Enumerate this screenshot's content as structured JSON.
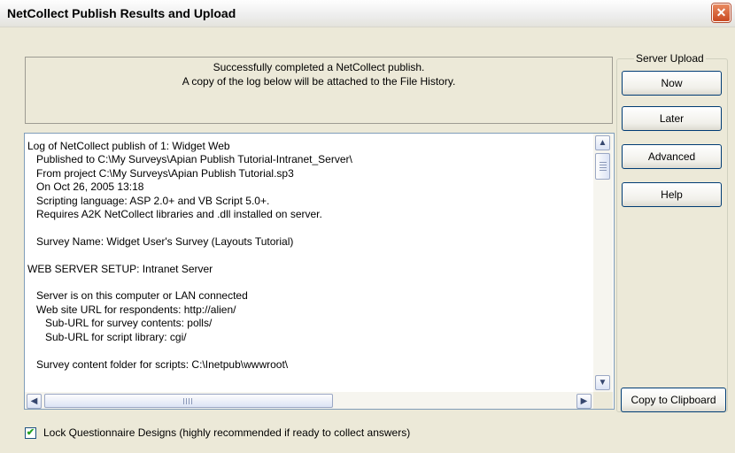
{
  "window": {
    "title": "NetCollect Publish Results and Upload",
    "close_glyph": "✕"
  },
  "message": {
    "line1": "Successfully completed a NetCollect publish.",
    "line2": "A copy of the log below will be attached to the File History."
  },
  "log": {
    "lines": [
      "Log of NetCollect publish of 1: Widget Web",
      "   Published to C:\\My Surveys\\Apian Publish Tutorial-Intranet_Server\\",
      "   From project C:\\My Surveys\\Apian Publish Tutorial.sp3",
      "   On Oct 26, 2005 13:18",
      "   Scripting language: ASP 2.0+ and VB Script 5.0+.",
      "   Requires A2K NetCollect libraries and .dll installed on server.",
      "",
      "   Survey Name: Widget User's Survey (Layouts Tutorial)",
      "",
      "WEB SERVER SETUP: Intranet Server",
      "",
      "   Server is on this computer or LAN connected",
      "   Web site URL for respondents: http://alien/",
      "      Sub-URL for survey contents: polls/",
      "      Sub-URL for script library: cgi/",
      "",
      "   Survey content folder for scripts: C:\\Inetpub\\wwwroot\\"
    ],
    "scroll_up_glyph": "▲",
    "scroll_down_glyph": "▼",
    "scroll_left_glyph": "◀",
    "scroll_right_glyph": "▶"
  },
  "server_upload": {
    "label": "Server Upload",
    "buttons": {
      "now": "Now",
      "later": "Later",
      "advanced": "Advanced",
      "help": "Help"
    }
  },
  "copy_button": "Copy to Clipboard",
  "lock_checkbox": {
    "label": "Lock Questionnaire Designs (highly recommended if ready to collect answers)",
    "checked": true,
    "glyph": "✔"
  }
}
